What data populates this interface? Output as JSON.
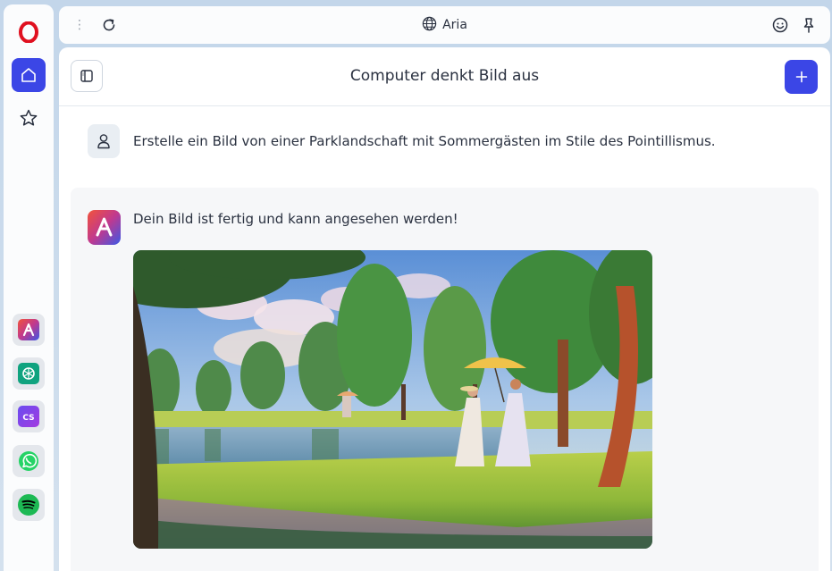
{
  "topbar": {
    "title": "Aria"
  },
  "sidebar": {
    "items": [
      {
        "name": "opera-logo-icon"
      },
      {
        "name": "home-icon"
      },
      {
        "name": "star-icon"
      }
    ],
    "apps": [
      {
        "name": "aria"
      },
      {
        "name": "chatgpt"
      },
      {
        "name": "chatsonic"
      },
      {
        "name": "whatsapp"
      },
      {
        "name": "spotify"
      }
    ],
    "cs_label": "CS"
  },
  "chat": {
    "title": "Computer denkt Bild aus",
    "user_message": "Erstelle ein Bild von einer Parklandschaft mit Sommergästen im Stile des Pointillismus.",
    "ai_message": "Dein Bild ist fertig und kann angesehen werden!"
  },
  "colors": {
    "accent": "#3b46e6",
    "opera_red": "#e0101f",
    "whatsapp": "#25d366",
    "spotify": "#1db954",
    "chatgpt": "#10a37f"
  }
}
